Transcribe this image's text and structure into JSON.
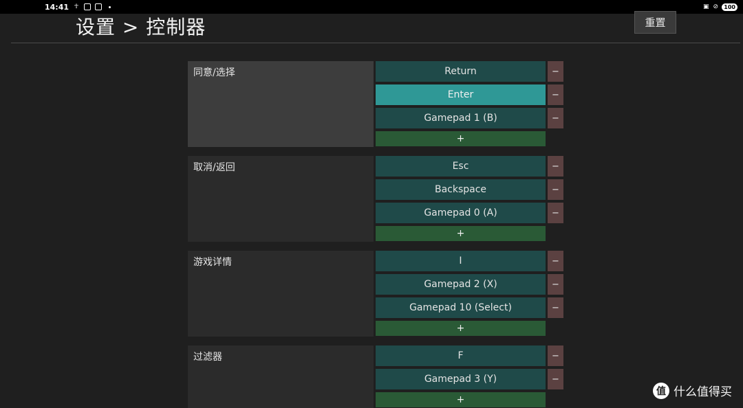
{
  "status": {
    "time": "14:41",
    "battery": "100",
    "icons": [
      "accessibility-icon",
      "screen-record-icon",
      "screen-cast-icon",
      "notification-dot-icon",
      "cast-icon",
      "do-not-disturb-icon"
    ]
  },
  "header": {
    "title": "设置 > 控制器",
    "reset_label": "重置"
  },
  "add_label": "+",
  "remove_label": "−",
  "groups": [
    {
      "label": "同意/选择",
      "bindings": [
        "Return",
        "Enter",
        "Gamepad 1 (B)"
      ],
      "active": true,
      "selected_binding": 1
    },
    {
      "label": "取消/返回",
      "bindings": [
        "Esc",
        "Backspace",
        "Gamepad 0 (A)"
      ]
    },
    {
      "label": "游戏详情",
      "bindings": [
        "I",
        "Gamepad 2 (X)",
        "Gamepad 10 (Select)"
      ]
    },
    {
      "label": "过滤器",
      "bindings": [
        "F",
        "Gamepad 3 (Y)"
      ]
    }
  ],
  "watermark": "什么值得买",
  "colors": {
    "background": "#1f1f1f",
    "binding": "#1f4a49",
    "binding_selected": "#2f9896",
    "remove": "#5b4141",
    "add": "#2a5a36",
    "label_active": "#3d3d3d",
    "label": "#2b2b2b"
  }
}
